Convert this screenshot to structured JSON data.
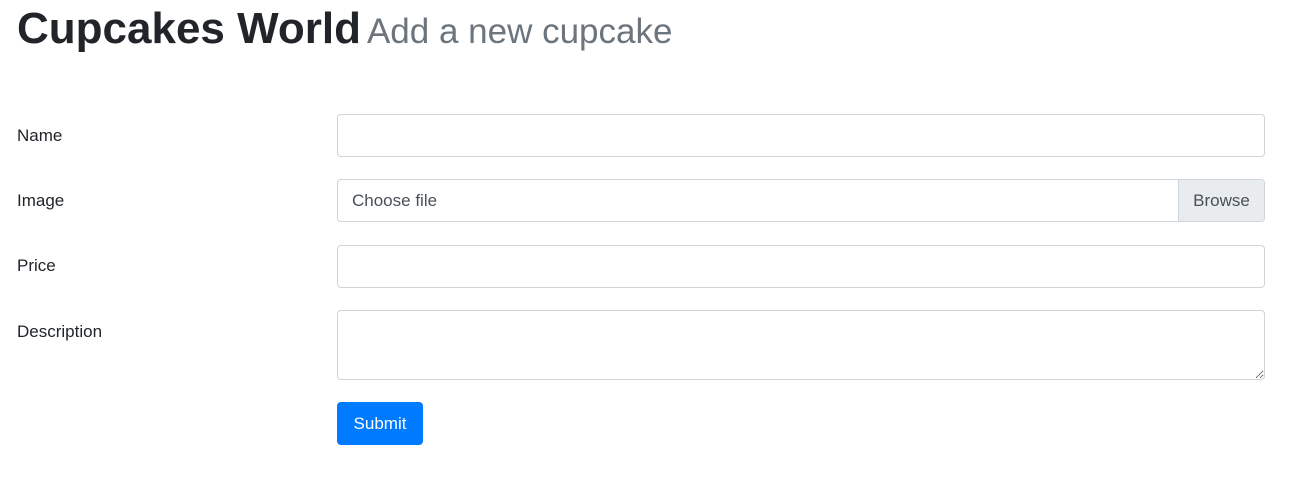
{
  "header": {
    "title": "Cupcakes World",
    "subtitle": "Add a new cupcake"
  },
  "form": {
    "name": {
      "label": "Name",
      "value": "",
      "placeholder": ""
    },
    "image": {
      "label": "Image",
      "file_label": "Choose file",
      "browse_label": "Browse"
    },
    "price": {
      "label": "Price",
      "value": "",
      "placeholder": ""
    },
    "description": {
      "label": "Description",
      "value": "",
      "placeholder": ""
    },
    "submit_label": "Submit"
  },
  "colors": {
    "primary": "#007bff",
    "heading": "#212529",
    "muted": "#6c757d",
    "border": "#ced4da",
    "browse_bg": "#e9ecef"
  }
}
